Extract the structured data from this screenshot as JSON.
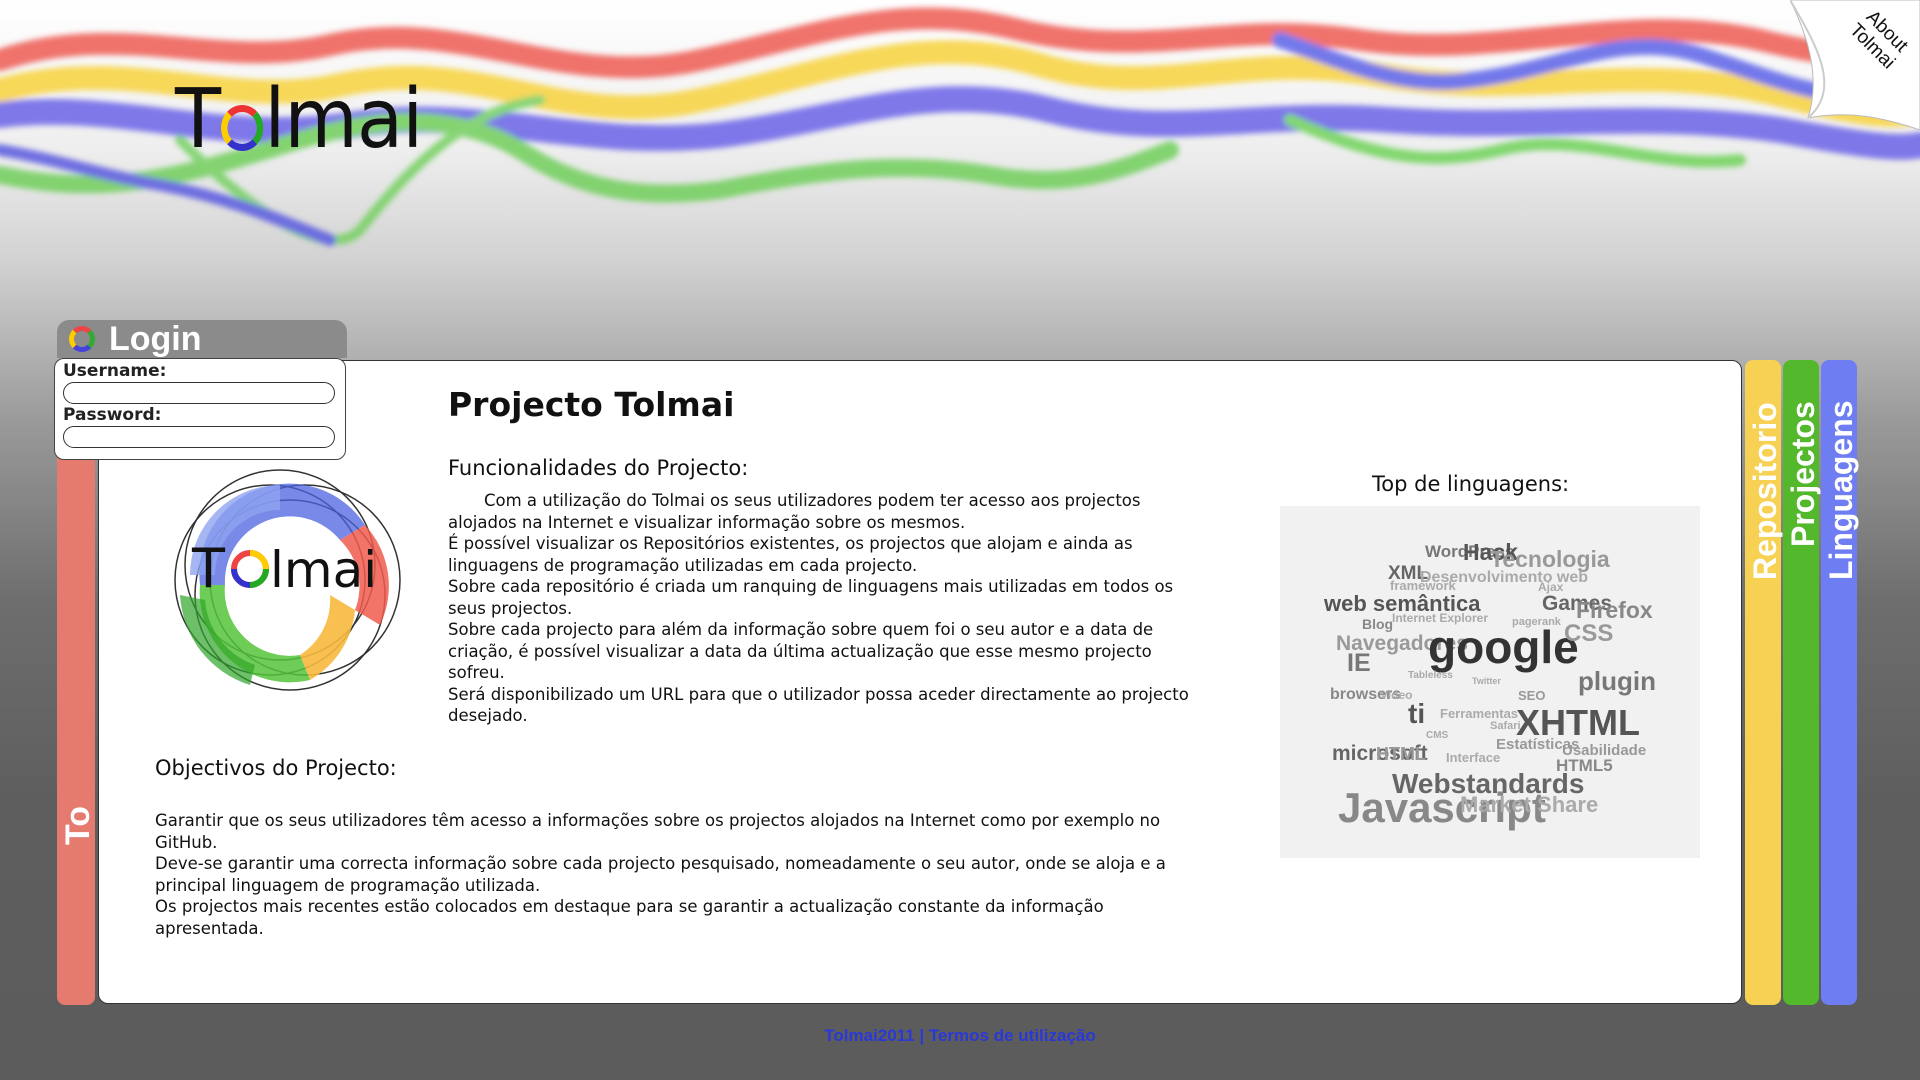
{
  "header": {
    "logo_text": "Tolmai",
    "about_label_line1": "About",
    "about_label_line2": "Tolmai"
  },
  "login": {
    "title": "Login",
    "username_label": "Username:",
    "password_label": "Password:"
  },
  "left_tab": {
    "label": "To"
  },
  "main": {
    "title": "Projecto Tolmai",
    "features_heading": "Funcionalidades do Projecto:",
    "features": [
      "Com a utilização do Tolmai os seus utilizadores podem ter acesso aos projectos alojados na Internet e visualizar informação sobre os mesmos.",
      "É possível visualizar os Repositórios existentes, os projectos que alojam e ainda as linguagens de programação utilizadas em cada projecto.",
      "Sobre cada repositório é criada um ranquing de linguagens mais utilizadas em todos os seus projectos.",
      "Sobre cada projecto para além da informação sobre quem foi o seu autor e a data de criação, é possível visualizar a data da última actualização que esse mesmo projecto sofreu.",
      "Será disponibilizado um URL para que o utilizador possa aceder directamente ao projecto desejado."
    ],
    "objectives_heading": "Objectivos do Projecto:",
    "objectives": [
      "Garantir que os seus utilizadores têm acesso a informações sobre os projectos alojados na Internet como por exemplo no GitHub.",
      "Deve-se garantir uma correcta informação sobre cada projecto pesquisado, nomeadamente o seu autor, onde se aloja e a principal linguagem de programação utilizada.",
      "Os projectos mais recentes estão colocados em destaque para se garantir a actualização constante da informação apresentada."
    ],
    "top_languages_title": "Top de linguagens:",
    "word_cloud": [
      "WordPress",
      "Hack",
      "Tecnologia",
      "XML",
      "Desenvolvimento web",
      "framework",
      "Ajax",
      "web semântica",
      "Games",
      "Firefox",
      "Blog",
      "Internet Explorer",
      "pagerank",
      "Navegadores",
      "google",
      "CSS",
      "IE",
      "Tableless",
      "Twitter",
      "plugin",
      "browsers",
      "Video",
      "SEO",
      "ti",
      "Ferramentas",
      "XHTML",
      "CMS",
      "Safari",
      "Estatísticas",
      "microsoft",
      "HTML",
      "Interface",
      "Usabilidade",
      "HTML5",
      "Webstandards",
      "Javascript",
      "Market Share"
    ]
  },
  "side_tabs": [
    {
      "label": "Repositorio",
      "color": "#f7d154"
    },
    {
      "label": "Projectos",
      "color": "#53b82c"
    },
    {
      "label": "Linguagens",
      "color": "#6f7df2"
    }
  ],
  "footer": {
    "copyright": "Tolmai2011",
    "separator": "|",
    "terms_link": "Termos de utilização"
  },
  "colors": {
    "red": "#e57a6e",
    "yellow": "#f7d154",
    "green": "#53b82c",
    "blue": "#6f7df2",
    "link": "#2a37d9"
  }
}
